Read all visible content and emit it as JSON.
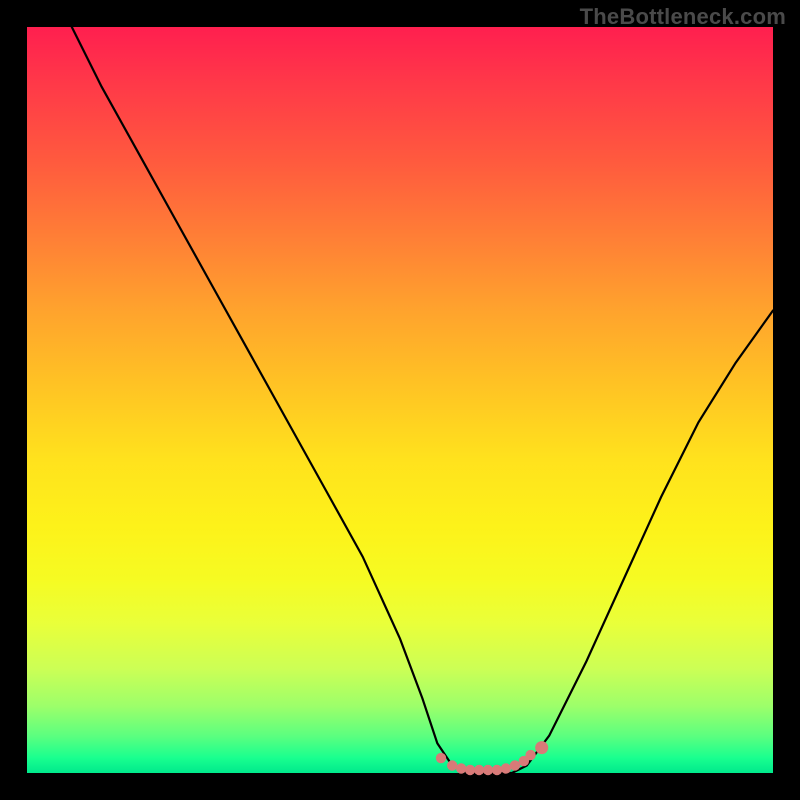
{
  "watermark_text": "TheBottleneck.com",
  "colors": {
    "frame_bg": "#000000",
    "gradient_top": "#ff1f4f",
    "gradient_bottom": "#00e98c",
    "curve_stroke": "#000000",
    "dot_fill": "#d87a78"
  },
  "chart_data": {
    "type": "line",
    "title": "",
    "xlabel": "",
    "ylabel": "",
    "xlim": [
      0,
      100
    ],
    "ylim": [
      0,
      100
    ],
    "grid": false,
    "legend": false,
    "series": [
      {
        "name": "bottleneck-curve",
        "x": [
          6,
          10,
          15,
          20,
          25,
          30,
          35,
          40,
          45,
          50,
          53,
          55,
          57,
          59,
          61,
          63,
          65,
          67,
          70,
          75,
          80,
          85,
          90,
          95,
          100
        ],
        "y": [
          100,
          92,
          83,
          74,
          65,
          56,
          47,
          38,
          29,
          18,
          10,
          4,
          1,
          0,
          0,
          0,
          0,
          1,
          5,
          15,
          26,
          37,
          47,
          55,
          62
        ]
      }
    ],
    "markers": {
      "name": "plateau-dots",
      "x": [
        55.5,
        57.0,
        58.2,
        59.4,
        60.6,
        61.8,
        63.0,
        64.2,
        65.4,
        66.6,
        67.5,
        69.0
      ],
      "y": [
        2.0,
        1.0,
        0.6,
        0.4,
        0.4,
        0.4,
        0.4,
        0.6,
        1.0,
        1.6,
        2.4,
        3.4
      ]
    },
    "highlight_point": {
      "x": 69.0,
      "y": 3.4
    }
  }
}
